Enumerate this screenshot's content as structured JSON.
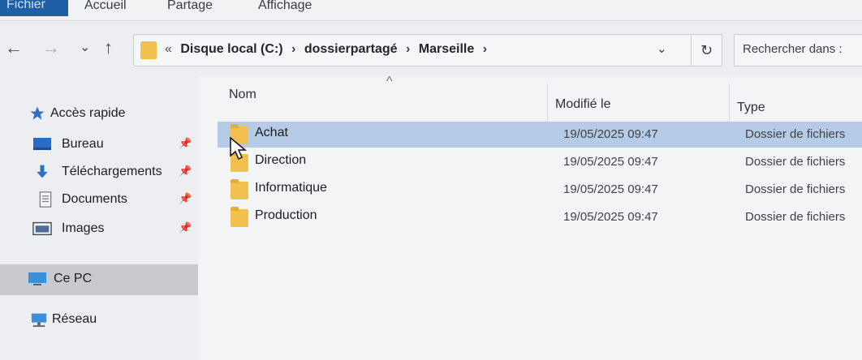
{
  "ribbon": {
    "tabs": [
      "Fichier",
      "Accueil",
      "Partage",
      "Affichage"
    ]
  },
  "nav": {
    "back": "←",
    "forward": "→",
    "recent": "⌄",
    "up": "↑"
  },
  "address": {
    "overflow": "«",
    "crumbs": [
      "Disque local (C:)",
      "dossierpartagé",
      "Marseille"
    ],
    "separator": "›",
    "dropdown": "⌄",
    "refresh": "↻"
  },
  "search": {
    "placeholder": "Rechercher dans :"
  },
  "sidebar": {
    "items": [
      {
        "label": "Accès rapide",
        "icon": "star-icon"
      },
      {
        "label": "Bureau",
        "icon": "desktop-icon",
        "pinned": true
      },
      {
        "label": "Téléchargements",
        "icon": "download-icon",
        "pinned": true
      },
      {
        "label": "Documents",
        "icon": "documents-icon",
        "pinned": true
      },
      {
        "label": "Images",
        "icon": "images-icon",
        "pinned": true
      },
      {
        "label": "Ce PC",
        "icon": "computer-icon",
        "selected": true
      },
      {
        "label": "Réseau",
        "icon": "network-icon"
      }
    ]
  },
  "table": {
    "columns": [
      "Nom",
      "Modifié le",
      "Type"
    ],
    "rows": [
      {
        "name": "Achat",
        "modified": "19/05/2025 09:47",
        "type": "Dossier de fichiers",
        "selected": true
      },
      {
        "name": "Direction",
        "modified": "19/05/2025 09:47",
        "type": "Dossier de fichiers"
      },
      {
        "name": "Informatique",
        "modified": "19/05/2025 09:47",
        "type": "Dossier de fichiers"
      },
      {
        "name": "Production",
        "modified": "19/05/2025 09:47",
        "type": "Dossier de fichiers"
      }
    ]
  },
  "colors": {
    "folder": "#f2c04e",
    "selection": "#b5cbe6",
    "file_tab": "#1f5fa6"
  }
}
